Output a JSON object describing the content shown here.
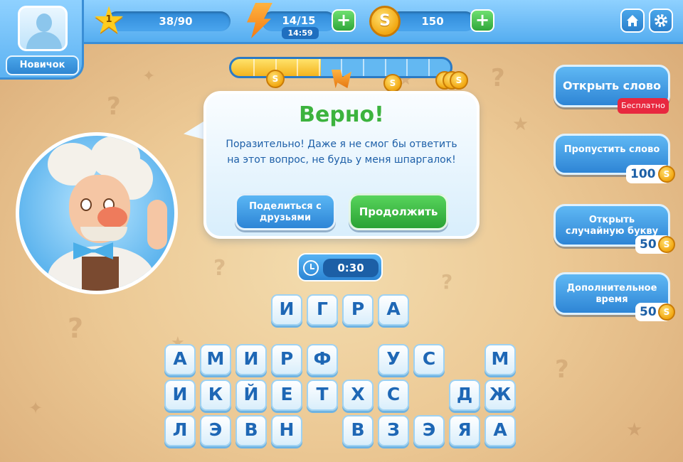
{
  "user": {
    "rank": "Новичок"
  },
  "level": {
    "number": "1",
    "progress": "38/90"
  },
  "energy": {
    "value": "14/15",
    "timer": "14:59"
  },
  "coins": {
    "value": "150"
  },
  "topbar": {
    "plus_label": "+",
    "coin_symbol": "S",
    "home_icon": "home-icon",
    "settings_icon": "gear-icon"
  },
  "progress_bar": {
    "fill_fraction": 0.41,
    "segments": 10
  },
  "dialog": {
    "title": "Верно!",
    "message": "Поразительно! Даже я не смог бы ответить на этот вопрос, не будь у меня шпаргалок!",
    "share_label": "Поделиться с друзьями",
    "continue_label": "Продолжить"
  },
  "timer": {
    "value": "0:30"
  },
  "answer": {
    "letters": [
      "И",
      "Г",
      "Р",
      "А"
    ]
  },
  "letters": {
    "row1": [
      "А",
      "М",
      "И",
      "Р",
      "Ф",
      "",
      "У",
      "С",
      "",
      "М"
    ],
    "row2": [
      "И",
      "К",
      "Й",
      "Е",
      "Т",
      "Х",
      "С",
      "",
      "Д",
      "Ж"
    ],
    "row3": [
      "Л",
      "Э",
      "В",
      "Н",
      "",
      "В",
      "З",
      "Э",
      "Я",
      "А"
    ]
  },
  "hints": {
    "open_word": {
      "label": "Открыть слово",
      "badge": "Бесплатно"
    },
    "skip_word": {
      "label": "Пропустить слово",
      "price": "100"
    },
    "random_letter": {
      "label": "Открыть случайную букву",
      "price": "50"
    },
    "extra_time": {
      "label": "Дополнительное время",
      "price": "50"
    }
  },
  "colors": {
    "accent_blue": "#2e85d5",
    "success_green": "#3cb33e",
    "coin_gold": "#f2a812",
    "badge_red": "#e8283f"
  }
}
